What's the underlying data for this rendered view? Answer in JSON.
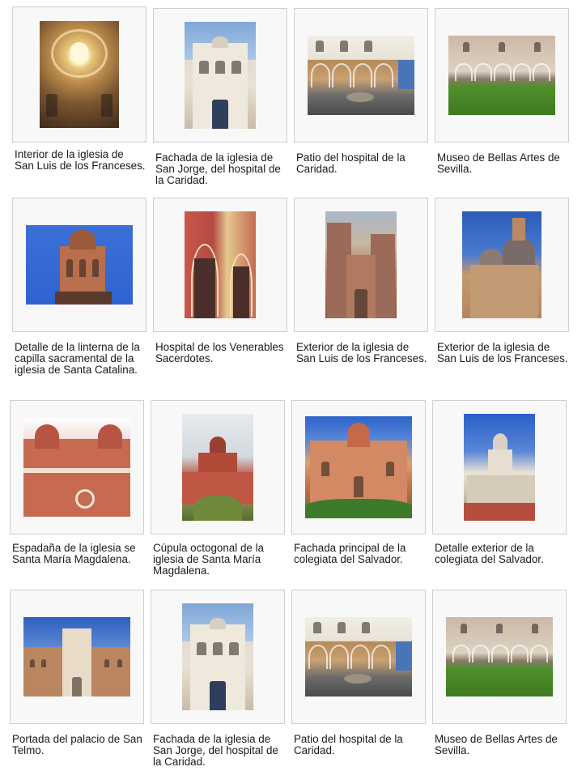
{
  "gallery": {
    "items": [
      {
        "caption": "Interior de la iglesia de San Luis de los Franceses.",
        "image": "interior-dome-photo"
      },
      {
        "caption": "Fachada de la iglesia de San Jorge, del hospital de la Caridad.",
        "image": "facade-photo"
      },
      {
        "caption": "Patio del hospital de la Caridad.",
        "image": "patio-photo"
      },
      {
        "caption": "Museo de Bellas Artes de Sevilla.",
        "image": "museum-courtyard-photo"
      },
      {
        "caption": "Detalle de la linterna de la capilla sacramental de la iglesia de Santa Catalina.",
        "image": "lantern-photo"
      },
      {
        "caption": "Hospital de los Venerables Sacerdotes.",
        "image": "hospital-facade-photo"
      },
      {
        "caption": "Exterior de la iglesia de San Luis de los Franceses.",
        "image": "church-exterior-photo"
      },
      {
        "caption": "Exterior de la iglesia de San Luis de los Franceses.",
        "image": "church-domes-photo"
      },
      {
        "caption": "Espadaña de la iglesia se Santa María Magdalena.",
        "image": "belfry-photo"
      },
      {
        "caption": "Cúpula octogonal de la iglesia de Santa María Magdalena.",
        "image": "octagonal-dome-photo"
      },
      {
        "caption": "Fachada principal de la colegiata del Salvador.",
        "image": "salvador-facade-photo"
      },
      {
        "caption": "Detalle exterior de la colegiata del Salvador.",
        "image": "salvador-detail-photo"
      },
      {
        "caption": "Portada del palacio de San Telmo.",
        "image": "palace-portal-photo"
      },
      {
        "caption": "Fachada de la iglesia de San Jorge, del hospital de la Caridad.",
        "image": "facade-photo"
      },
      {
        "caption": "Patio del hospital de la Caridad.",
        "image": "patio-photo"
      },
      {
        "caption": "Museo de Bellas Artes de Sevilla.",
        "image": "museum-courtyard-photo"
      }
    ]
  },
  "colors": {
    "frame_background": "#f8f8f8",
    "frame_border": "#cfcfcf",
    "caption_text": "#1a1a1a"
  }
}
